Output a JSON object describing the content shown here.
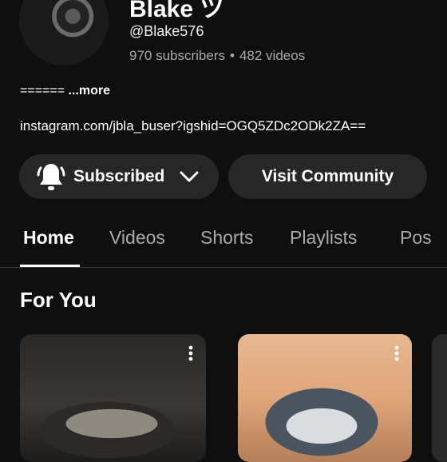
{
  "channel": {
    "name": "Blake ツ",
    "handle": "@Blake576",
    "subscribers": "970 subscribers",
    "separator": "•",
    "videos": "482 videos",
    "description": "====== ",
    "more_label": "...more",
    "link": "instagram.com/jbla_buser?igshid=OGQ5ZDc2ODk2ZA=="
  },
  "buttons": {
    "subscribed": "Subscribed",
    "visit_community": "Visit Community"
  },
  "tabs": [
    {
      "label": "Home",
      "active": true
    },
    {
      "label": "Videos"
    },
    {
      "label": "Shorts"
    },
    {
      "label": "Playlists"
    },
    {
      "label": "Pos"
    }
  ],
  "section": {
    "title": "For You"
  },
  "icons": {
    "bell": "bell-icon",
    "chevron": "chevron-down-icon",
    "kebab": "more-vert-icon"
  },
  "colors": {
    "background": "#0f0f0f",
    "button_bg": "#272727",
    "secondary_text": "#aaaaaa"
  }
}
